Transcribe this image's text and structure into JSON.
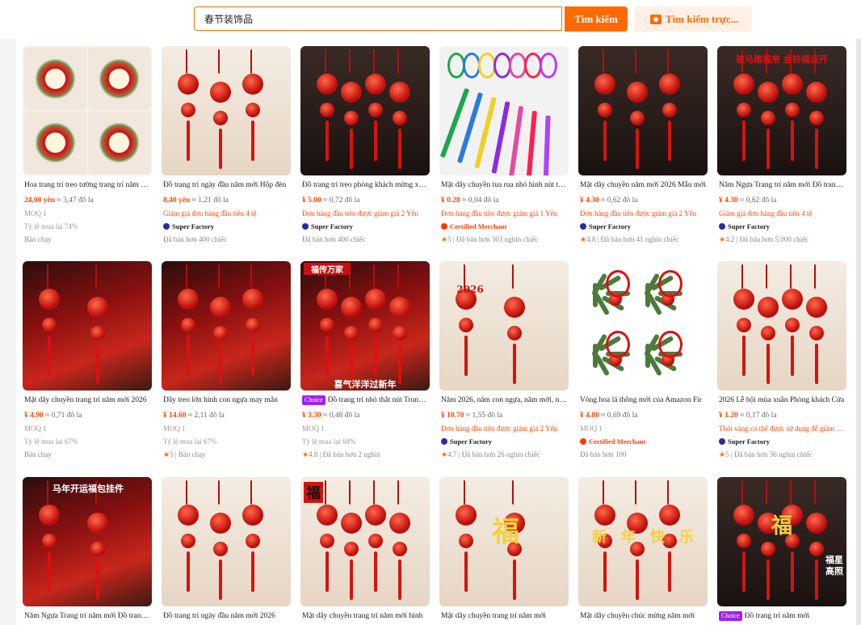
{
  "search": {
    "query": "春节装饰品",
    "button_label": "Tìm kiếm",
    "image_search_label": "Tìm kiếm trực..."
  },
  "products": [
    {
      "title": "Hoa trang trí treo tường trang trí năm mới",
      "price": "24,00 yên",
      "conv": "≈ 3,47 đô la",
      "line1": "MOQ 1",
      "line1_style": "gray",
      "line2": "Tỷ lệ mua lại 74%",
      "line2_style": "gray",
      "line3": "Bán chạy"
    },
    {
      "title": "Đồ trang trí ngày đầu năm mới Hộp đèn",
      "price": "8,40 yên",
      "conv": "≈ 1,21 đô la",
      "line1": "Giảm giá đơn hàng đầu tiên 4 tệ",
      "line1_style": "red",
      "badge": "Super Factory",
      "line3": "Đã bán hơn 400 chiếc"
    },
    {
      "title": "Đồ trang trí treo phòng khách mừng xuân",
      "price": "¥ 5.00",
      "conv": "≈ 0,72 đô la",
      "line1": "Đơn hàng đầu tiên được giảm giá 2 Yên",
      "line1_style": "red",
      "badge": "Super Factory",
      "line3": "Đã bán hơn 400 chiếc"
    },
    {
      "title": "Mặt dây chuyền tua rua nhỏ hình nút thắt",
      "price": "¥ 0.28",
      "conv": "≈ 0,04 đô la",
      "line1": "Đơn hàng đầu tiên được giảm giá 1 Yên",
      "line1_style": "red",
      "badge": "Certified Merchant",
      "rating": "5",
      "line3": "Đã bán hơn 303 nghìn chiếc"
    },
    {
      "title": "Mặt dây chuyền năm mới 2026 Mẫu mới",
      "price": "¥ 4.30",
      "conv": "≈ 0,62 đô la",
      "line1": "Đơn hàng đầu tiên được giảm giá 2 Yên",
      "line1_style": "red",
      "badge": "Super Factory",
      "rating": "4.8",
      "line3": "Đã bán hơn 41 nghìn chiếc"
    },
    {
      "title": "Năm Ngựa Trang trí năm mới Đồ trang trí",
      "price": "¥ 4.30",
      "conv": "≈ 0,62 đô la",
      "line1": "Giảm giá đơn hàng đầu tiên 4 tệ",
      "line1_style": "red",
      "badge": "Super Factory",
      "rating": "4.2",
      "line3": "Đã bán hơn 5.000 chiếc"
    },
    {
      "title": "Mặt dây chuyền trang trí năm mới 2026",
      "price": "¥ 4.90",
      "conv": "≈ 0,71 đô la",
      "line1": "MOQ 1",
      "line1_style": "gray",
      "line2": "Tỷ lệ mua lại 67%",
      "line2_style": "gray",
      "line3": "Bán chạy"
    },
    {
      "title": "Dây treo lớn hình con ngựa may mắn",
      "price": "¥ 14.60",
      "conv": "≈ 2,11 đô la",
      "line1": "MOQ 1",
      "line1_style": "gray",
      "line2": "Tỷ lệ mua lại 67%",
      "line2_style": "gray",
      "rating": "5",
      "line3": "Bán chạy"
    },
    {
      "title": "Đồ trang trí nhỏ thắt nút Trung Quốc",
      "choice": "Choice",
      "price": "¥ 3.30",
      "conv": "≈ 0,48 đô la",
      "line1": "MOQ 1",
      "line1_style": "gray",
      "line2": "Tỷ lệ mua lại 68%",
      "line2_style": "gray",
      "rating": "4.8",
      "line3": "Đã bán hơn 2 nghìn"
    },
    {
      "title": "Năm 2026, năm con ngựa, năm mới, năm mới",
      "price": "¥ 10.70",
      "conv": "≈ 1,55 đô la",
      "line1": "Đơn hàng đầu tiên được giảm giá 2 Yên",
      "line1_style": "red",
      "badge": "Super Factory",
      "rating": "4.7",
      "line3": "Đã bán hơn 26 nghìn chiếc"
    },
    {
      "title": "Vòng hoa lá thông mới của Amazon Fir",
      "price": "¥ 4.80",
      "conv": "≈ 0,69 đô la",
      "line1": "MOQ 1",
      "line1_style": "gray",
      "badge": "Certified Merchant",
      "line3": "Đã bán hơn 100"
    },
    {
      "title": "2026 Lễ hội mùa xuân Phòng khách Cửa",
      "price": "¥ 1.20",
      "conv": "≈ 0,17 đô la",
      "line1": "Thỏi vàng có thể được sử dụng để giảm giá",
      "line1_style": "red",
      "badge": "Super Factory",
      "rating": "5",
      "line3": "Đã bán hơn 36 nghìn chiếc"
    },
    {
      "title": "Năm Ngựa Trang trí năm mới Đồ trang trí"
    },
    {
      "title": "Đồ trang trí ngày đầu năm mới 2026"
    },
    {
      "title": "Mặt dây chuyền trang trí năm mới hình"
    },
    {
      "title": "Mặt dây chuyền trang trí năm mới"
    },
    {
      "title": "Mặt dây chuyền chúc mừng năm mới"
    },
    {
      "title": "Đồ trang trí năm mới",
      "choice": "Choice"
    }
  ],
  "image_text": {
    "p6_top": "骏马踏福来 金铃福运开",
    "p9_banner": "福传万家",
    "p9_bottom": "喜气洋洋过新年",
    "p10_year": "2026",
    "p13_top": "马年开运福包挂件",
    "p15_glyph": "福",
    "p16_glyph": "福",
    "p17_glyphs": [
      "新",
      "年",
      "快",
      "乐"
    ],
    "p18_glyph": "福",
    "p18_side": "福星高照"
  },
  "colors": {
    "accent": "#ff6a00",
    "price": "#ff4400",
    "choice": "#a020f0",
    "super_factory": "#2a2aa0"
  }
}
